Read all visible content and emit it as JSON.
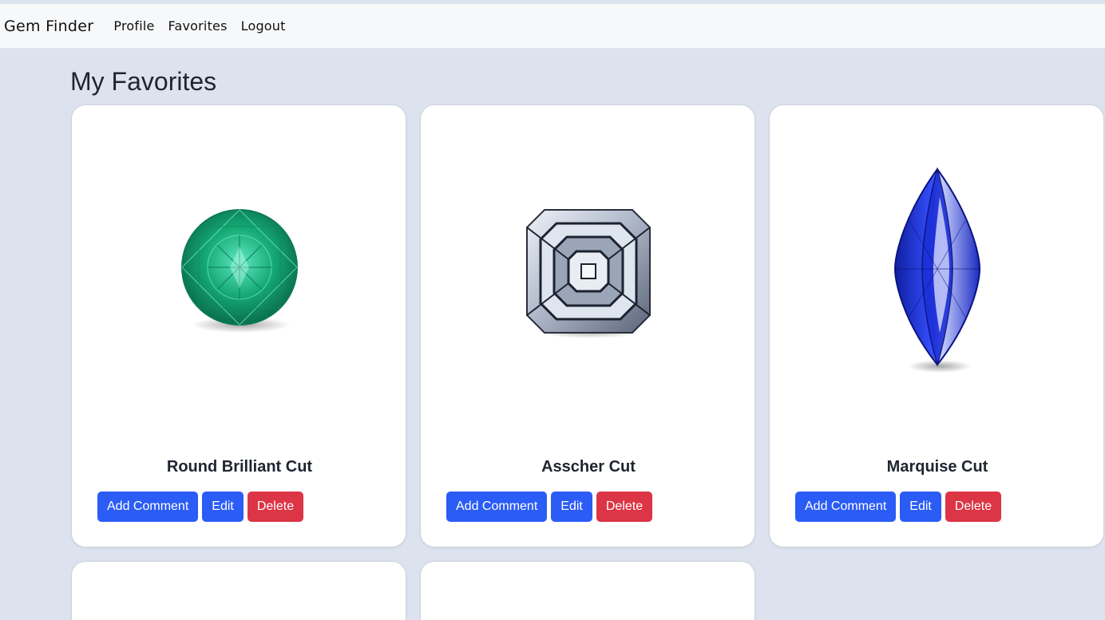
{
  "nav": {
    "brand": "Gem Finder",
    "links": [
      "Profile",
      "Favorites",
      "Logout"
    ]
  },
  "page": {
    "title": "My Favorites"
  },
  "cards": [
    {
      "title": "Round Brilliant Cut",
      "gem_color": "#1aa676",
      "buttons": {
        "comment": "Add Comment",
        "edit": "Edit",
        "delete": "Delete"
      }
    },
    {
      "title": "Asscher Cut",
      "gem_color": "#c9d0dc",
      "buttons": {
        "comment": "Add Comment",
        "edit": "Edit",
        "delete": "Delete"
      }
    },
    {
      "title": "Marquise Cut",
      "gem_color": "#2a3bd8",
      "buttons": {
        "comment": "Add Comment",
        "edit": "Edit",
        "delete": "Delete"
      }
    }
  ],
  "colors": {
    "primary": "#2b5cf6",
    "danger": "#dc3545",
    "background": "#dde3ee"
  }
}
